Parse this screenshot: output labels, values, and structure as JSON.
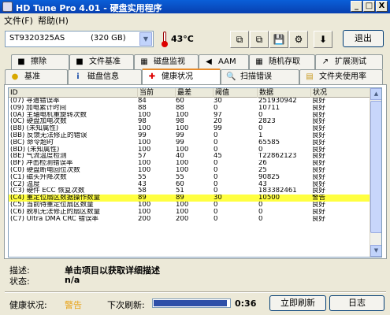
{
  "window": {
    "title": "HD Tune Pro 4.01 - 硬盘实用程序",
    "min": "_",
    "max": "□",
    "close": "X"
  },
  "menu": {
    "file": "文件(F)",
    "help": "帮助(H)"
  },
  "drive": {
    "name": "ST9320325AS",
    "capacity": "(320 GB)",
    "arrow": "▼"
  },
  "temperature": "43°C",
  "toolbar": {
    "btn1": "⧉",
    "btn2": "⧉",
    "btn3": "💾",
    "btn4": "⚙",
    "btn5": "⬇",
    "exit_label": "退出"
  },
  "tabs_top": [
    {
      "label": "擦除",
      "icon": "■"
    },
    {
      "label": "文件基准",
      "icon": "■"
    },
    {
      "label": "磁盘监视",
      "icon": "▦"
    },
    {
      "label": "AAM",
      "icon": "◀"
    },
    {
      "label": "随机存取",
      "icon": "▦"
    },
    {
      "label": "扩展测试",
      "icon": "↗"
    }
  ],
  "tabs_bottom": [
    {
      "label": "基准",
      "icon": "●"
    },
    {
      "label": "磁盘信息",
      "icon": "i"
    },
    {
      "label": "健康状况",
      "icon": "✚"
    },
    {
      "label": "扫描错误",
      "icon": "🔍"
    },
    {
      "label": "文件夹使用率",
      "icon": "▤"
    }
  ],
  "table": {
    "headers": [
      "ID",
      "当前",
      "最差",
      "阈值",
      "数据",
      "状况"
    ],
    "rows": [
      [
        "(07) 寻道错误率",
        "84",
        "60",
        "30",
        "251930942",
        "良好"
      ],
      [
        "(09) 加电累计时间",
        "88",
        "88",
        "0",
        "10711",
        "良好"
      ],
      [
        "(0A) 主轴电机重旋转次数",
        "100",
        "100",
        "97",
        "0",
        "良好"
      ],
      [
        "(0C) 硬盘加电次数",
        "98",
        "98",
        "20",
        "2823",
        "良好"
      ],
      [
        "(B8) (未知属性)",
        "100",
        "100",
        "99",
        "0",
        "良好"
      ],
      [
        "(BB) 反馈无法修正的错误",
        "99",
        "99",
        "0",
        "1",
        "良好"
      ],
      [
        "(BC) 命令超时",
        "100",
        "99",
        "0",
        "65585",
        "良好"
      ],
      [
        "(BD) (未知属性)",
        "100",
        "100",
        "0",
        "0",
        "良好"
      ],
      [
        "(BE) 气流温度检测",
        "57",
        "40",
        "45",
        "T22862123",
        "良好"
      ],
      [
        "(BF) 冲击检测错误率",
        "100",
        "100",
        "0",
        "26",
        "良好"
      ],
      [
        "(C0) 硬盘断电回位次数",
        "100",
        "100",
        "0",
        "25",
        "良好"
      ],
      [
        "(C1) 磁头升降次数",
        "55",
        "55",
        "0",
        "90825",
        "良好"
      ],
      [
        "(C2) 温度",
        "43",
        "60",
        "0",
        "43",
        "良好"
      ],
      [
        "(C3) 硬件 ECC 恢复次数",
        "58",
        "51",
        "0",
        "183382461",
        "良好"
      ],
      [
        "(C4) 重定位扇区数据操作数量",
        "89",
        "89",
        "30",
        "10500",
        "警告"
      ],
      [
        "(C5) 当前待重定位扇区数量",
        "100",
        "100",
        "0",
        "0",
        "良好"
      ],
      [
        "(C6) 脱机无法修正的扇区数量",
        "100",
        "100",
        "0",
        "0",
        "良好"
      ],
      [
        "(C7) Ultra DMA CRC 错误率",
        "200",
        "200",
        "0",
        "0",
        "良好"
      ]
    ]
  },
  "details": {
    "desc_label": "描述:",
    "desc_value": "单击项目以获取详细描述",
    "state_label": "状态:",
    "state_value": "n/a"
  },
  "status": {
    "health_label": "健康状况:",
    "health_value": "警告",
    "next_refresh_label": "下次刷新:",
    "progress": 0.97,
    "time": "0:36",
    "refresh_button": "立即刷新",
    "log_button": "日志"
  }
}
